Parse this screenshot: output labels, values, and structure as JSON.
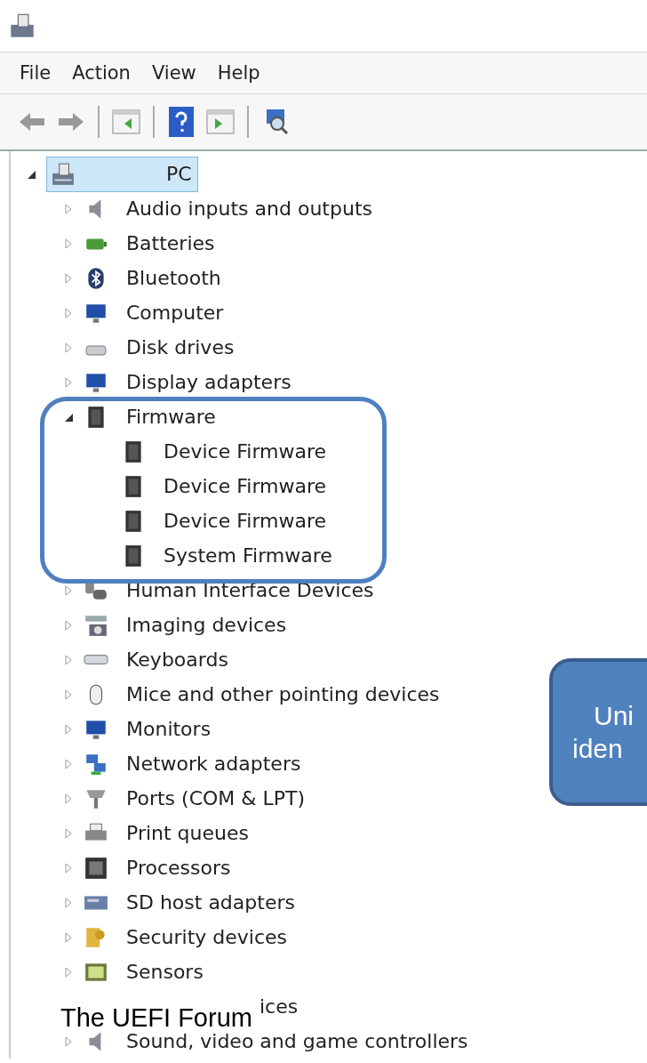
{
  "menu": [
    "File",
    "Action",
    "View",
    "Help"
  ],
  "tree": {
    "label": "PC",
    "selected": true,
    "expanded": true,
    "children": [
      {
        "label": "Audio inputs and outputs",
        "selected": false,
        "expanded": false
      },
      {
        "label": "Batteries",
        "selected": false,
        "expanded": false
      },
      {
        "label": "Bluetooth",
        "selected": false,
        "expanded": false
      },
      {
        "label": "Computer",
        "selected": false,
        "expanded": false
      },
      {
        "label": "Disk drives",
        "selected": false,
        "expanded": false
      },
      {
        "label": "Display adapters",
        "selected": false,
        "expanded": false
      },
      {
        "label": "Firmware",
        "selected": false,
        "expanded": true,
        "children": [
          {
            "label": "Device Firmware",
            "selected": false
          },
          {
            "label": "Device Firmware",
            "selected": false
          },
          {
            "label": "Device Firmware",
            "selected": false
          },
          {
            "label": "System Firmware",
            "selected": false
          }
        ]
      },
      {
        "label": "Human Interface Devices",
        "selected": false,
        "expanded": false
      },
      {
        "label": "Imaging devices",
        "selected": false,
        "expanded": false
      },
      {
        "label": "Keyboards",
        "selected": false,
        "expanded": false
      },
      {
        "label": "Mice and other pointing devices",
        "selected": false,
        "expanded": false
      },
      {
        "label": "Monitors",
        "selected": false,
        "expanded": false
      },
      {
        "label": "Network adapters",
        "selected": false,
        "expanded": false
      },
      {
        "label": "Ports (COM & LPT)",
        "selected": false,
        "expanded": false
      },
      {
        "label": "Print queues",
        "selected": false,
        "expanded": false
      },
      {
        "label": "Processors",
        "selected": false,
        "expanded": false
      },
      {
        "label": "SD host adapters",
        "selected": false,
        "expanded": false
      },
      {
        "label": "Security devices",
        "selected": false,
        "expanded": false
      },
      {
        "label": "Sensors",
        "selected": false,
        "expanded": false
      },
      {
        "label": "ices",
        "selected": false
      },
      {
        "label": "Sound, video and game controllers",
        "selected": false,
        "expanded": false
      }
    ]
  },
  "callout": {
    "lines": [
      "Uni",
      "iden"
    ]
  },
  "footer": "The UEFI Forum"
}
